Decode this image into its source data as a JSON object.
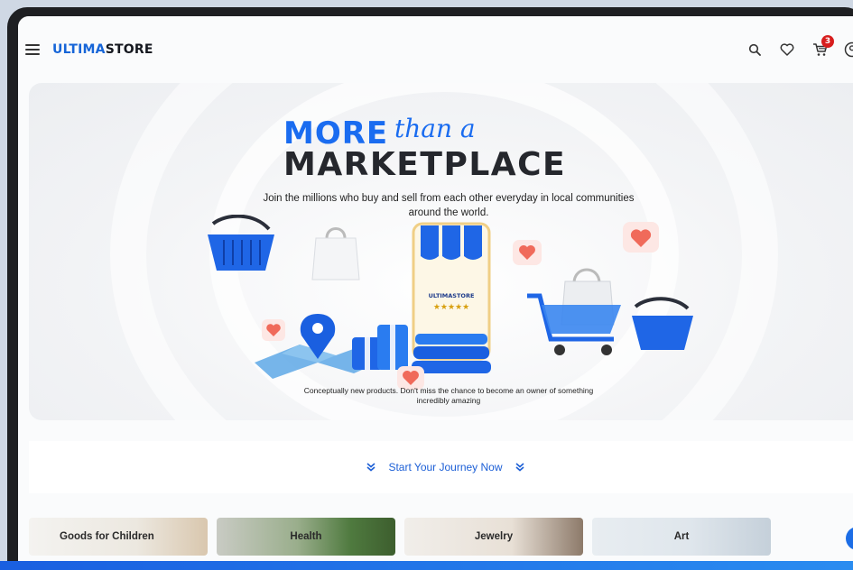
{
  "header": {
    "logo_primary": "ULTIMA",
    "logo_secondary": "STORE",
    "cart_count": "3"
  },
  "hero": {
    "title_word": "MORE",
    "title_script": "than a",
    "title_line2": "MARKETPLACE",
    "subtitle": "Join the millions who buy and sell from each other everyday in local communities around the world.",
    "store_sign": "ULTIMASTORE",
    "store_stars": "★★★★★",
    "footnote": "Conceptually new products. Don't miss the chance to become an owner of something incredibly amazing"
  },
  "journey": {
    "label": "Start Your Journey Now"
  },
  "categories": [
    {
      "label": "Goods for Children"
    },
    {
      "label": "Health"
    },
    {
      "label": "Jewelry"
    },
    {
      "label": "Art"
    }
  ],
  "help": {
    "label": "?"
  },
  "colors": {
    "accent": "#1a6cf0",
    "badge": "#d71d1d",
    "dark_text": "#25272d"
  },
  "icons": [
    "menu-icon",
    "search-icon",
    "heart-icon",
    "cart-icon",
    "account-icon",
    "chevrons-down-icon"
  ]
}
